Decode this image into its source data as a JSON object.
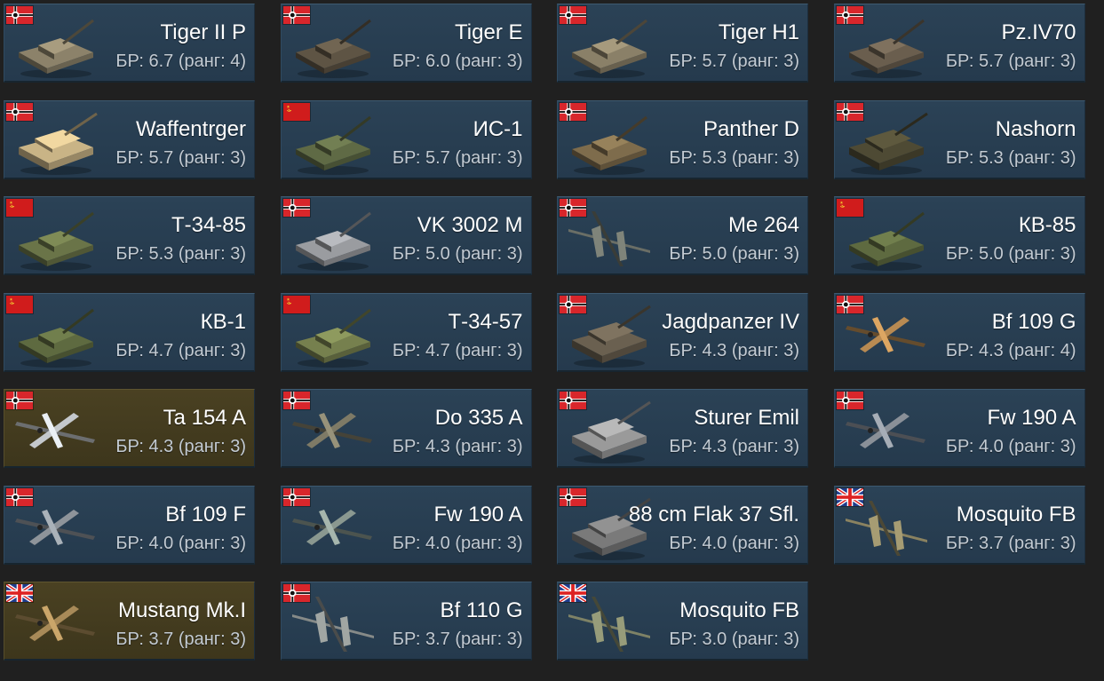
{
  "colors": {
    "background": "#202020",
    "card": "#2b4256",
    "card_premium": "#4a4122",
    "name_text": "#ffffff",
    "br_text": "#c3cbd3"
  },
  "vehicles": [
    {
      "name": "Tiger II P",
      "br": "БР: 6.7 (ранг: 4)",
      "nation": "germany",
      "type": "tank",
      "color": "#8c826a",
      "premium": false
    },
    {
      "name": "Tiger E",
      "br": "БР: 6.0 (ранг: 3)",
      "nation": "germany",
      "type": "tank",
      "color": "#5e5444",
      "premium": false
    },
    {
      "name": "Tiger H1",
      "br": "БР: 5.7 (ранг: 3)",
      "nation": "germany",
      "type": "tank",
      "color": "#8a8068",
      "premium": false
    },
    {
      "name": "Pz.IV70",
      "br": "БР: 5.7 (ранг: 3)",
      "nation": "germany",
      "type": "tank",
      "color": "#6a5e4e",
      "premium": false
    },
    {
      "name": "Waffentrger",
      "br": "БР: 5.7 (ранг: 3)",
      "nation": "germany",
      "type": "spg",
      "color": "#c9b486",
      "premium": false
    },
    {
      "name": "ИС-1",
      "br": "БР: 5.7 (ранг: 3)",
      "nation": "ussr",
      "type": "tank",
      "color": "#5f6a45",
      "premium": false
    },
    {
      "name": "Panther D",
      "br": "БР: 5.3 (ранг: 3)",
      "nation": "germany",
      "type": "tank",
      "color": "#7e6c4c",
      "premium": false
    },
    {
      "name": "Nashorn",
      "br": "БР: 5.3 (ранг: 3)",
      "nation": "germany",
      "type": "spg",
      "color": "#4e4a34",
      "premium": false
    },
    {
      "name": "Т-34-85",
      "br": "БР: 5.3 (ранг: 3)",
      "nation": "ussr",
      "type": "tank",
      "color": "#6a7448",
      "premium": false
    },
    {
      "name": "VK 3002 M",
      "br": "БР: 5.0 (ранг: 3)",
      "nation": "germany",
      "type": "tank",
      "color": "#9a9ca0",
      "premium": false
    },
    {
      "name": "Me 264",
      "br": "БР: 5.0 (ранг: 3)",
      "nation": "germany",
      "type": "bomber",
      "color": "#6a6e66",
      "premium": false
    },
    {
      "name": "КВ-85",
      "br": "БР: 5.0 (ранг: 3)",
      "nation": "ussr",
      "type": "tank",
      "color": "#5e6a40",
      "premium": false
    },
    {
      "name": "КВ-1",
      "br": "БР: 4.7 (ранг: 3)",
      "nation": "ussr",
      "type": "tank",
      "color": "#5e6a40",
      "premium": false
    },
    {
      "name": "Т-34-57",
      "br": "БР: 4.7 (ранг: 3)",
      "nation": "ussr",
      "type": "tank",
      "color": "#76804e",
      "premium": false
    },
    {
      "name": "Jagdpanzer IV",
      "br": "БР: 4.3 (ранг: 3)",
      "nation": "germany",
      "type": "spg",
      "color": "#6a6050",
      "premium": false
    },
    {
      "name": "Bf 109 G",
      "br": "БР: 4.3 (ранг: 4)",
      "nation": "germany",
      "type": "fighter",
      "color": "#b88a52",
      "premium": false
    },
    {
      "name": "Ta 154 A",
      "br": "БР: 4.3 (ранг: 3)",
      "nation": "germany",
      "type": "fighter",
      "color": "#c4c8cc",
      "premium": true
    },
    {
      "name": "Do 335 A",
      "br": "БР: 4.3 (ранг: 3)",
      "nation": "germany",
      "type": "fighter",
      "color": "#7e7a66",
      "premium": false
    },
    {
      "name": "Sturer Emil",
      "br": "БР: 4.3 (ранг: 3)",
      "nation": "germany",
      "type": "spg",
      "color": "#9a9a9a",
      "premium": false
    },
    {
      "name": "Fw 190 A",
      "br": "БР: 4.0 (ранг: 3)",
      "nation": "germany",
      "type": "fighter",
      "color": "#8a9098",
      "premium": false
    },
    {
      "name": "Bf 109 F",
      "br": "БР: 4.0 (ранг: 3)",
      "nation": "germany",
      "type": "fighter",
      "color": "#8e949a",
      "premium": false
    },
    {
      "name": "Fw 190 A",
      "br": "БР: 4.0 (ранг: 3)",
      "nation": "germany",
      "type": "fighter",
      "color": "#8a9890",
      "premium": false
    },
    {
      "name": "88 cm Flak 37 Sfl.",
      "br": "БР: 4.0 (ранг: 3)",
      "nation": "germany",
      "type": "spg",
      "color": "#7a7a7a",
      "premium": false
    },
    {
      "name": "Mosquito FB",
      "br": "БР: 3.7 (ранг: 3)",
      "nation": "uk",
      "type": "bomber",
      "color": "#8a8260",
      "premium": false
    },
    {
      "name": "Mustang Mk.I",
      "br": "БР: 3.7 (ранг: 3)",
      "nation": "uk",
      "type": "fighter",
      "color": "#a88a58",
      "premium": true
    },
    {
      "name": "Bf 110 G",
      "br": "БР: 3.7 (ранг: 3)",
      "nation": "germany",
      "type": "bomber",
      "color": "#868a88",
      "premium": false
    },
    {
      "name": "Mosquito FB",
      "br": "БР: 3.0 (ранг: 3)",
      "nation": "uk",
      "type": "bomber",
      "color": "#7e8266",
      "premium": false
    }
  ]
}
